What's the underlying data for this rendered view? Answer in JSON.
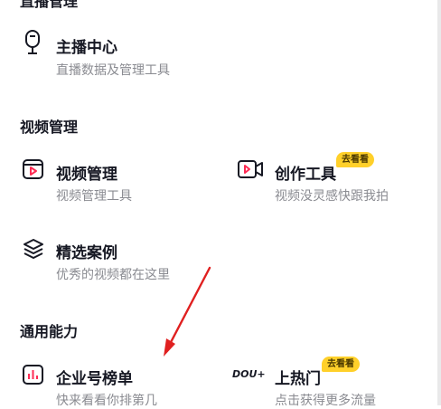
{
  "sections": {
    "live": {
      "title": "直播管理"
    },
    "video": {
      "title": "视频管理"
    },
    "general": {
      "title": "通用能力"
    }
  },
  "items": {
    "streamer_center": {
      "title": "主播中心",
      "subtitle": "直播数据及管理工具",
      "icon": "microphone-icon"
    },
    "video_manage": {
      "title": "视频管理",
      "subtitle": "视频管理工具",
      "icon": "play-square-icon"
    },
    "creation_tools": {
      "title": "创作工具",
      "subtitle": "视频没灵感快跟我拍",
      "icon": "video-camera-icon",
      "badge": "去看看"
    },
    "featured_cases": {
      "title": "精选案例",
      "subtitle": "优秀的视频都在这里",
      "icon": "layers-icon"
    },
    "enterprise_ranking": {
      "title": "企业号榜单",
      "subtitle": "快来看看你排第几",
      "icon": "bar-chart-icon"
    },
    "trending": {
      "title": "上热门",
      "subtitle": "点击获得更多流量",
      "icon": "dou-plus-icon",
      "logo_text": "DOU+",
      "badge": "去看看"
    }
  },
  "colors": {
    "accent": "#fe2c55",
    "badge": "#ffd02a",
    "annotation_arrow": "#e02020"
  }
}
